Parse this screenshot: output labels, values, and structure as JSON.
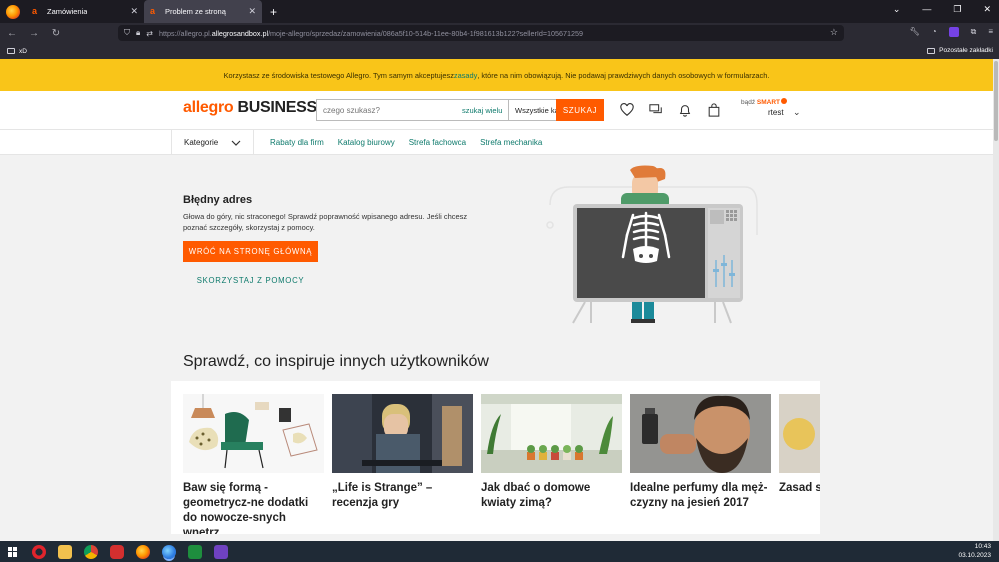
{
  "browser": {
    "tabs": [
      {
        "label": "Zamówienia",
        "active": false
      },
      {
        "label": "Problem ze stroną",
        "active": true
      }
    ],
    "url_prefix": "https://allegro.pl.",
    "url_domain": "allegrosandbox.pl",
    "url_rest": "/moje-allegro/sprzedaz/zamowienia/086a5f10-514b-11ee-80b4-1f981613b122?sellerId=105671259",
    "bookmarks": {
      "left": "xD",
      "right": "Pozostałe zakładki"
    }
  },
  "notice": {
    "before": "Korzystasz ze środowiska testowego Allegro. Tym samym akceptujesz ",
    "link": "zasady",
    "after": ", które na nim obowiązują. Nie podawaj prawdziwych danych osobowych w formularzach."
  },
  "header": {
    "logo_a": "allegro",
    "logo_b": " BUSINESS",
    "search_placeholder": "czego szukasz?",
    "search_wide": "szukaj wielu",
    "category": "Wszystkie kategorie",
    "search_button": "SZUKAJ",
    "account_prefix": "bądź ",
    "account_smart": "SMART",
    "username": "rtest"
  },
  "catnav": {
    "selector": "Kategorie",
    "links": [
      "Rabaty dla firm",
      "Katalog biurowy",
      "Strefa fachowca",
      "Strefa mechanika"
    ]
  },
  "error": {
    "title": "Błędny adres",
    "text": "Głowa do góry, nic straconego! Sprawdź poprawność wpisanego adresu. Jeśli chcesz poznać szczegóły, skorzystaj z pomocy.",
    "home_button": "WRÓĆ NA STRONĘ GŁÓWNĄ",
    "help_button": "SKORZYSTAJ Z POMOCY"
  },
  "inspire": {
    "title": "Sprawdź, co inspiruje innych użytkowników",
    "articles": [
      {
        "title": "Baw się formą - geometrycz-ne dodatki do nowocze-snych wnętrz"
      },
      {
        "title": "„Life is Strange” – recenzja gry"
      },
      {
        "title": "Jak dbać o domowe kwiaty zimą?"
      },
      {
        "title": "Idealne perfumy dla męż-czyzny na jesień 2017"
      },
      {
        "title": "Zasad samoc"
      }
    ]
  },
  "taskbar": {
    "time": "10:43",
    "date": "03.10.2023"
  },
  "colors": {
    "accent": "#ff5a00",
    "link": "#0e7a6c",
    "notice_bg": "#f9c519"
  }
}
